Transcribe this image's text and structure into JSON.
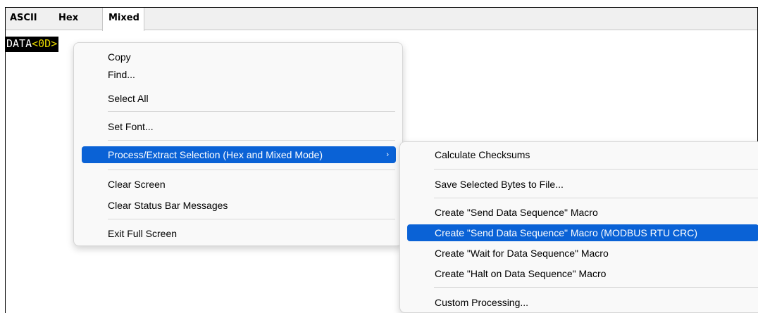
{
  "tabs": {
    "ascii": "ASCII",
    "hex": "Hex",
    "mixed": "Mixed"
  },
  "terminal": {
    "text": "DATA",
    "ctrl": "<0D>"
  },
  "context_menu": {
    "copy": "Copy",
    "find": "Find...",
    "select_all": "Select All",
    "set_font": "Set Font...",
    "process_extract": "Process/Extract Selection (Hex and Mixed Mode)",
    "submenu_arrow": "›",
    "clear_screen": "Clear Screen",
    "clear_status": "Clear Status Bar Messages",
    "exit_full_screen": "Exit Full Screen"
  },
  "sub_menu": {
    "checksums": "Calculate Checksums",
    "save_bytes": "Save Selected Bytes to File...",
    "send_macro": "Create \"Send Data Sequence\" Macro",
    "send_macro_modbus": "Create \"Send Data Sequence\" Macro (MODBUS RTU CRC)",
    "wait_macro": "Create \"Wait for Data Sequence\" Macro",
    "halt_macro": "Create \"Halt on Data Sequence\" Macro",
    "custom": "Custom Processing..."
  },
  "colors": {
    "highlight": "#0a62d6",
    "terminal_bg": "#000000",
    "ctrl_text": "#e8d800"
  }
}
